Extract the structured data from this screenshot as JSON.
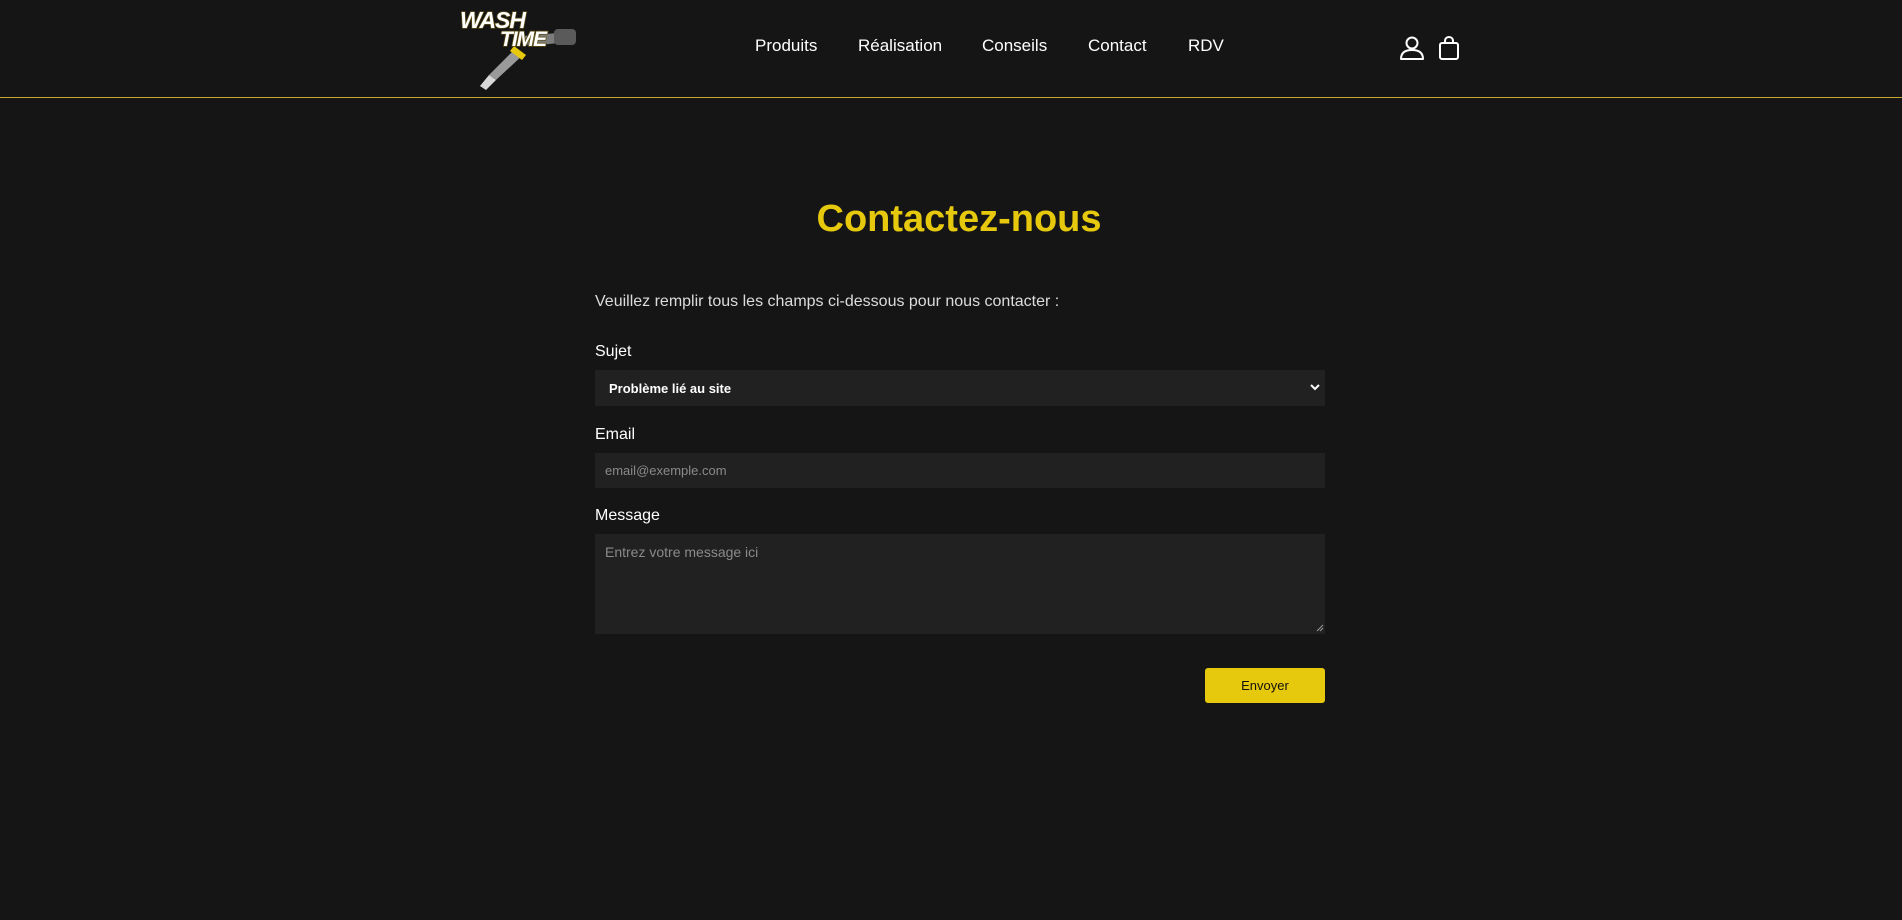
{
  "brand": {
    "logo_line1": "WASH",
    "logo_line2": "TIME",
    "accent": "#e6c80c"
  },
  "nav": {
    "items": [
      {
        "label": "Produits"
      },
      {
        "label": "Réalisation"
      },
      {
        "label": "Conseils"
      },
      {
        "label": "Contact"
      },
      {
        "label": "RDV"
      }
    ]
  },
  "header_icons": {
    "account": "user-icon",
    "cart": "shopping-bag-icon"
  },
  "page": {
    "title": "Contactez-nous",
    "intro": "Veuillez remplir tous les champs ci-dessous pour nous contacter :"
  },
  "form": {
    "subject_label": "Sujet",
    "subject_value": "Problème lié au site",
    "email_label": "Email",
    "email_value": "",
    "email_placeholder": "email@exemple.com",
    "message_label": "Message",
    "message_value": "",
    "message_placeholder": "Entrez votre message ici",
    "submit_label": "Envoyer"
  }
}
